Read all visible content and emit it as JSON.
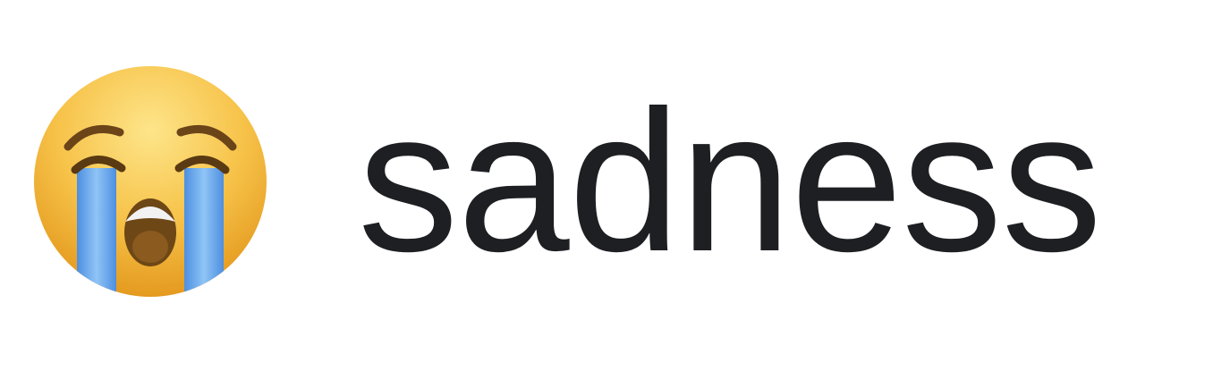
{
  "emoji": {
    "icon": "loudly-crying-face-icon",
    "colors": {
      "face_light": "#fde58a",
      "face_mid": "#f7c34a",
      "face_dark": "#e49a1f",
      "tears": "#5aa0ea",
      "tears_light": "#8fc4f6",
      "mouth": "#6e4716",
      "teeth": "#f2f2f2",
      "brows": "#6b4418"
    }
  },
  "label": {
    "text": "sadness",
    "color": "#1d1f22"
  }
}
